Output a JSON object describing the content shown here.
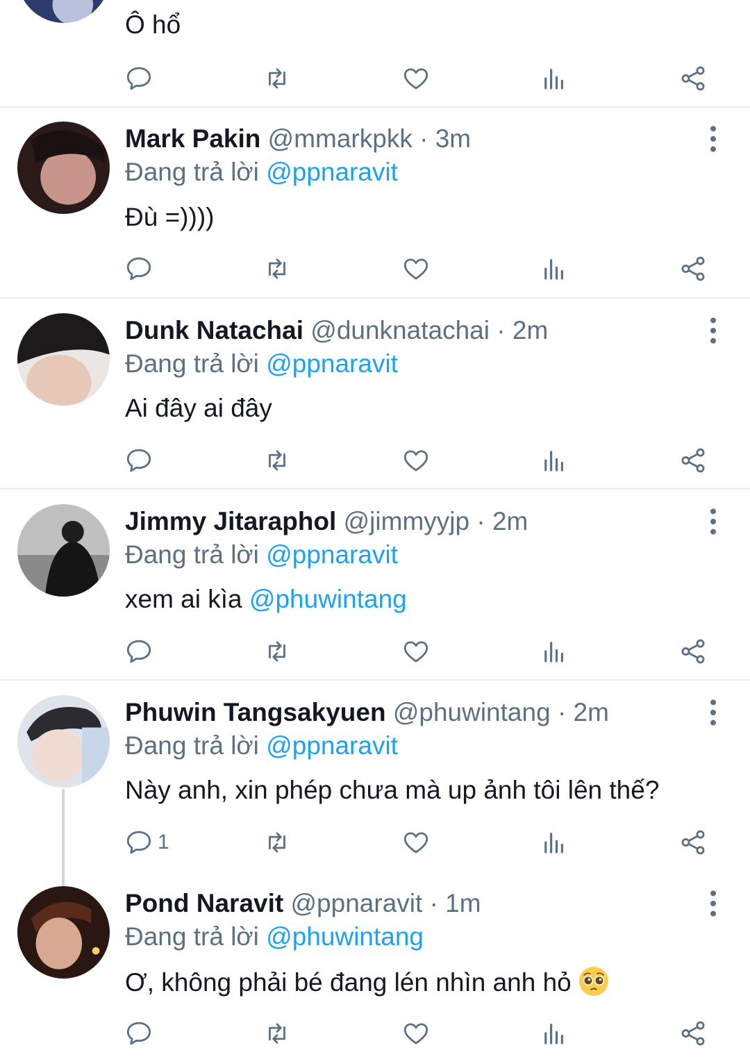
{
  "colors": {
    "accent": "#1da1f2",
    "secondary_text": "#5b7083",
    "primary_text": "#141823",
    "divider": "#e6ecf0"
  },
  "top_partial": {
    "text": "Ô hổ"
  },
  "replying_prefix": "Đang trả lời",
  "tweets": [
    {
      "name": "Mark Pakin",
      "handle": "@mmarkpkk",
      "dot": "·",
      "time": "3m",
      "replying_to": "@ppnaravit",
      "text": "Đù =))))"
    },
    {
      "name": "Dunk Natachai",
      "handle": "@dunknatachai",
      "dot": "·",
      "time": "2m",
      "replying_to": "@ppnaravit",
      "text": "Ai đây ai đây"
    },
    {
      "name": "Jimmy Jitaraphol",
      "handle": "@jimmyyjp",
      "dot": "·",
      "time": "2m",
      "replying_to": "@ppnaravit",
      "text": "xem ai kìa",
      "text_mention": "@phuwintang"
    },
    {
      "name": "Phuwin Tangsakyuen",
      "handle": "@phuwintang",
      "dot": "·",
      "time": "2m",
      "replying_to": "@ppnaravit",
      "text": "Này anh, xin phép chưa mà up ảnh tôi lên thế?",
      "reply_count": "1"
    },
    {
      "name": "Pond Naravit",
      "handle": "@ppnaravit",
      "dot": "·",
      "time": "1m",
      "replying_to": "@phuwintang",
      "text": "Ơ, không phải bé đang lén nhìn anh hỏ",
      "emoji": "pleading-face-emoji"
    }
  ],
  "icons": {
    "reply": "reply-icon",
    "retweet": "retweet-icon",
    "like": "heart-icon",
    "analytics": "analytics-icon",
    "share": "share-icon",
    "more": "more-vertical-icon"
  }
}
